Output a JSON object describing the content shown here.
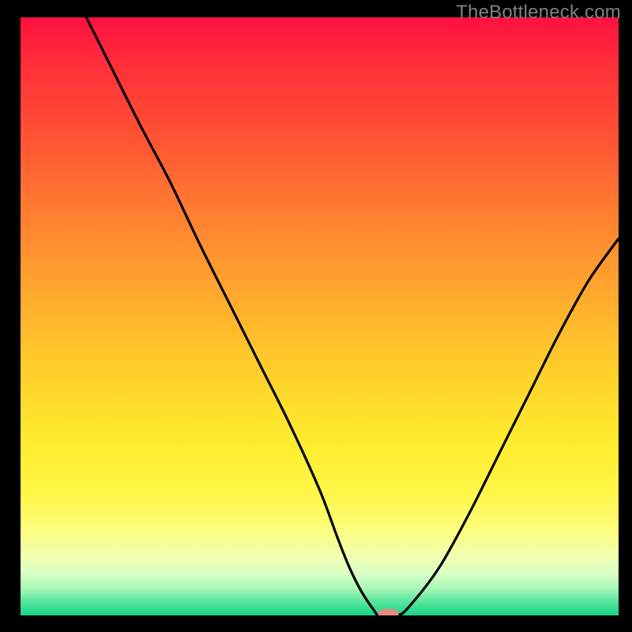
{
  "watermark": "TheBottleneck.com",
  "chart_data": {
    "type": "line",
    "title": "",
    "xlabel": "",
    "ylabel": "",
    "xlim": [
      0,
      100
    ],
    "ylim": [
      0,
      100
    ],
    "series": [
      {
        "name": "curve",
        "x": [
          11,
          15,
          20,
          25,
          30,
          35,
          40,
          45,
          50,
          53,
          55,
          57,
          59,
          60,
          63,
          65,
          70,
          75,
          80,
          85,
          90,
          95,
          100
        ],
        "y": [
          100,
          92,
          82,
          72.5,
          62,
          52,
          42,
          32,
          21,
          13,
          8,
          4,
          1,
          0,
          0,
          1.5,
          8,
          17,
          27,
          37,
          47,
          56,
          63
        ]
      }
    ],
    "marker": {
      "name": "min-marker",
      "x": 61.5,
      "y": 0,
      "color": "#e88a83"
    },
    "gradient_stops": [
      {
        "pos": 0.0,
        "color": "#ff1040"
      },
      {
        "pos": 0.5,
        "color": "#ffb82d"
      },
      {
        "pos": 0.8,
        "color": "#fff74a"
      },
      {
        "pos": 0.93,
        "color": "#d9ffc4"
      },
      {
        "pos": 1.0,
        "color": "#19d586"
      }
    ]
  }
}
